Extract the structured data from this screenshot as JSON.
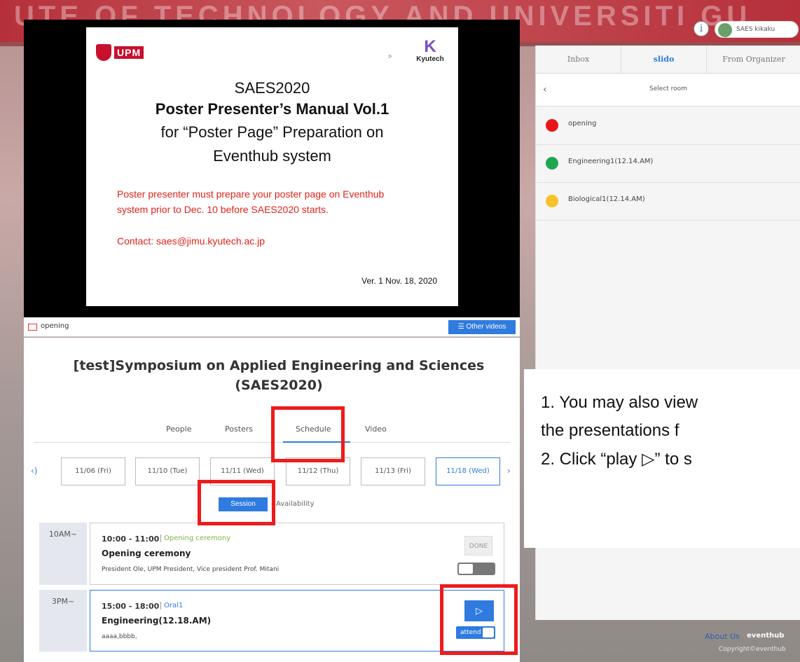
{
  "background": {
    "banner_text": "UTE OF TECHNOLOGY AND UNIVERSITI GU"
  },
  "video": {
    "slide": {
      "upm_logo_text": "UPM",
      "kyutech_logo_text": "Kyutech",
      "title": "SAES2020",
      "main_title": "Poster Presenter’s Manual Vol.1",
      "subtitle_line1": "for “Poster Page” Preparation on",
      "subtitle_line2": "Eventhub system",
      "note_line1": "Poster presenter must prepare your poster page on Eventhub",
      "note_line2": "system prior to Dec. 10 before SAES2020 starts.",
      "contact": "Contact: saes@jimu.kyutech.ac.jp",
      "version": "Ver. 1 Nov. 18, 2020"
    },
    "bar": {
      "label": "opening",
      "other_videos": "☰ Other videos"
    }
  },
  "event": {
    "title": "[test]Symposium on Applied Engineering and Sciences (SAES2020)"
  },
  "tabs": [
    "People",
    "Posters",
    "Schedule",
    "Video"
  ],
  "active_tab": "Schedule",
  "dates": [
    "11/06 (Fri)",
    "11/10 (Tue)",
    "11/11 (Wed)",
    "11/12 (Thu)",
    "11/13 (Fri)",
    "11/18 (Wed)"
  ],
  "date_nav": {
    "prev": "‹)",
    "next": "›"
  },
  "active_date": "11/18 (Wed)",
  "view_toggle": {
    "session": "Session",
    "availability": "Availability"
  },
  "sessions": [
    {
      "slot": "10AM~",
      "time": "10:00 - 11:00",
      "tag": "Opening ceremony",
      "tag_color": "#7cb342",
      "title": "Opening ceremony",
      "desc": "President Ole, UPM President, Vice president Prof. Mitani",
      "status": "DONE"
    },
    {
      "slot": "3PM~",
      "time": "15:00 - 18:00",
      "tag": "Oral1",
      "tag_color": "#2f7be0",
      "title": "Engineering(12.18.AM)",
      "desc": "aaaa,bbbb,",
      "play": "▷",
      "attend": "attend"
    }
  ],
  "right_panel": {
    "tabs": [
      "Inbox",
      "slido",
      "From Organizer"
    ],
    "active_tab": "slido",
    "room_header": "Select room",
    "back": "‹",
    "rooms": [
      {
        "name": "opening",
        "color": "#e8161c"
      },
      {
        "name": "Engineering1(12.14.AM)",
        "color": "#1fa653"
      },
      {
        "name": "Biological1(12.14.AM)",
        "color": "#f9c22b"
      }
    ]
  },
  "user": {
    "info_icon": "i",
    "name": "SAES kikaku"
  },
  "instructions": {
    "line1": "1. You may also view",
    "line2": "the presentations f",
    "line3": "2. Click “play ▷” to s"
  },
  "footer": {
    "about": "About Us",
    "brand": "eventhub",
    "copyright": "Copyright©eventhub"
  },
  "colors": {
    "accent": "#2f7be0",
    "highlight": "#ee1b1b"
  }
}
